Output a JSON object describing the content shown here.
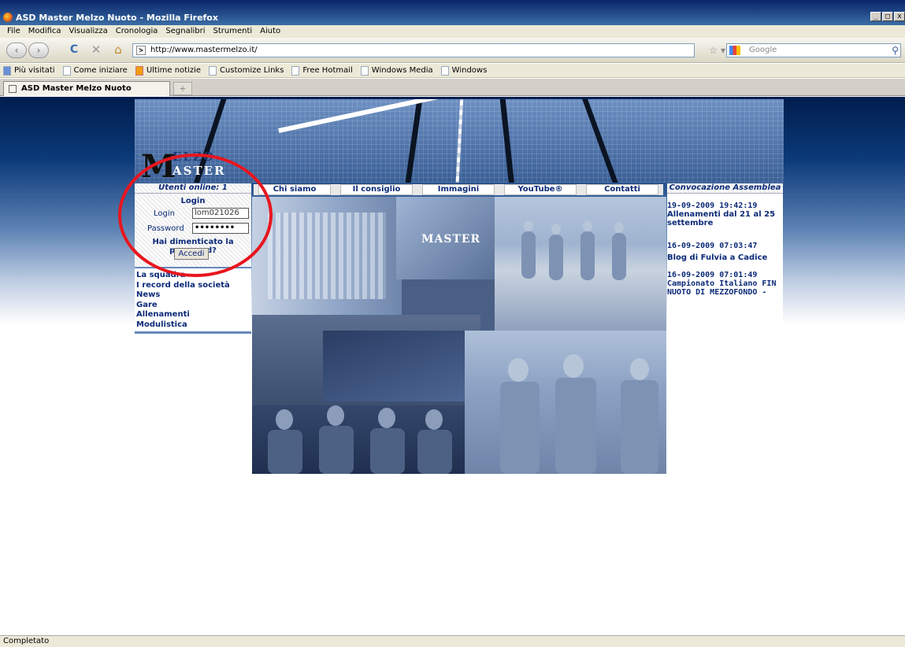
{
  "window": {
    "title": "ASD Master Melzo Nuoto - Mozilla Firefox",
    "minimize": "_",
    "maximize": "□",
    "close": "x"
  },
  "menu": [
    "File",
    "Modifica",
    "Visualizza",
    "Cronologia",
    "Segnalibri",
    "Strumenti",
    "Aiuto"
  ],
  "toolbar": {
    "url": "http://www.mastermelzo.it/",
    "search_placeholder": "Google",
    "back": "‹",
    "forward": "›",
    "reload": "C",
    "stop": "✕",
    "home": "⌂",
    "star": "☆ ▾",
    "search_go": "⚲"
  },
  "bookmarks": [
    "Più visitati",
    "Come iniziare",
    "Ultime notizie",
    "Customize Links",
    "Free Hotmail",
    "Windows Media",
    "Windows"
  ],
  "tab": {
    "title": "ASD Master Melzo Nuoto",
    "new_tab": "+"
  },
  "site": {
    "logo": {
      "letter": "M",
      "word1": "ELZO",
      "word2": "ASTER"
    },
    "online": "Utenti online: 1",
    "login": {
      "title": "Login",
      "login_label": "Login",
      "login_value": "lom021026",
      "password_label": "Password",
      "password_value": "••••••••",
      "forgot": "Hai dimenticato la password?",
      "button": "Accedi"
    },
    "nav": [
      "Chi siamo",
      "Il consiglio",
      "Immagini",
      "YouTube®",
      "Contatti"
    ],
    "side_menu": [
      "La squadra",
      "I record della società",
      "News",
      "Gare",
      "Allenamenti",
      "Modulistica"
    ],
    "right_title": "Convocazione Assemblea",
    "news": [
      {
        "date": "19-09-2009 19:42:19",
        "title": "Allenamenti dal 21 al 25 settembre"
      },
      {
        "date": "16-09-2009 07:03:47",
        "title": "Blog di Fulvia a Cadice"
      },
      {
        "date": "16-09-2009 07:01:49",
        "title": "Campionato Italiano FIN NUOTO DI MEZZOFONDO -"
      }
    ]
  },
  "status": "Completato"
}
